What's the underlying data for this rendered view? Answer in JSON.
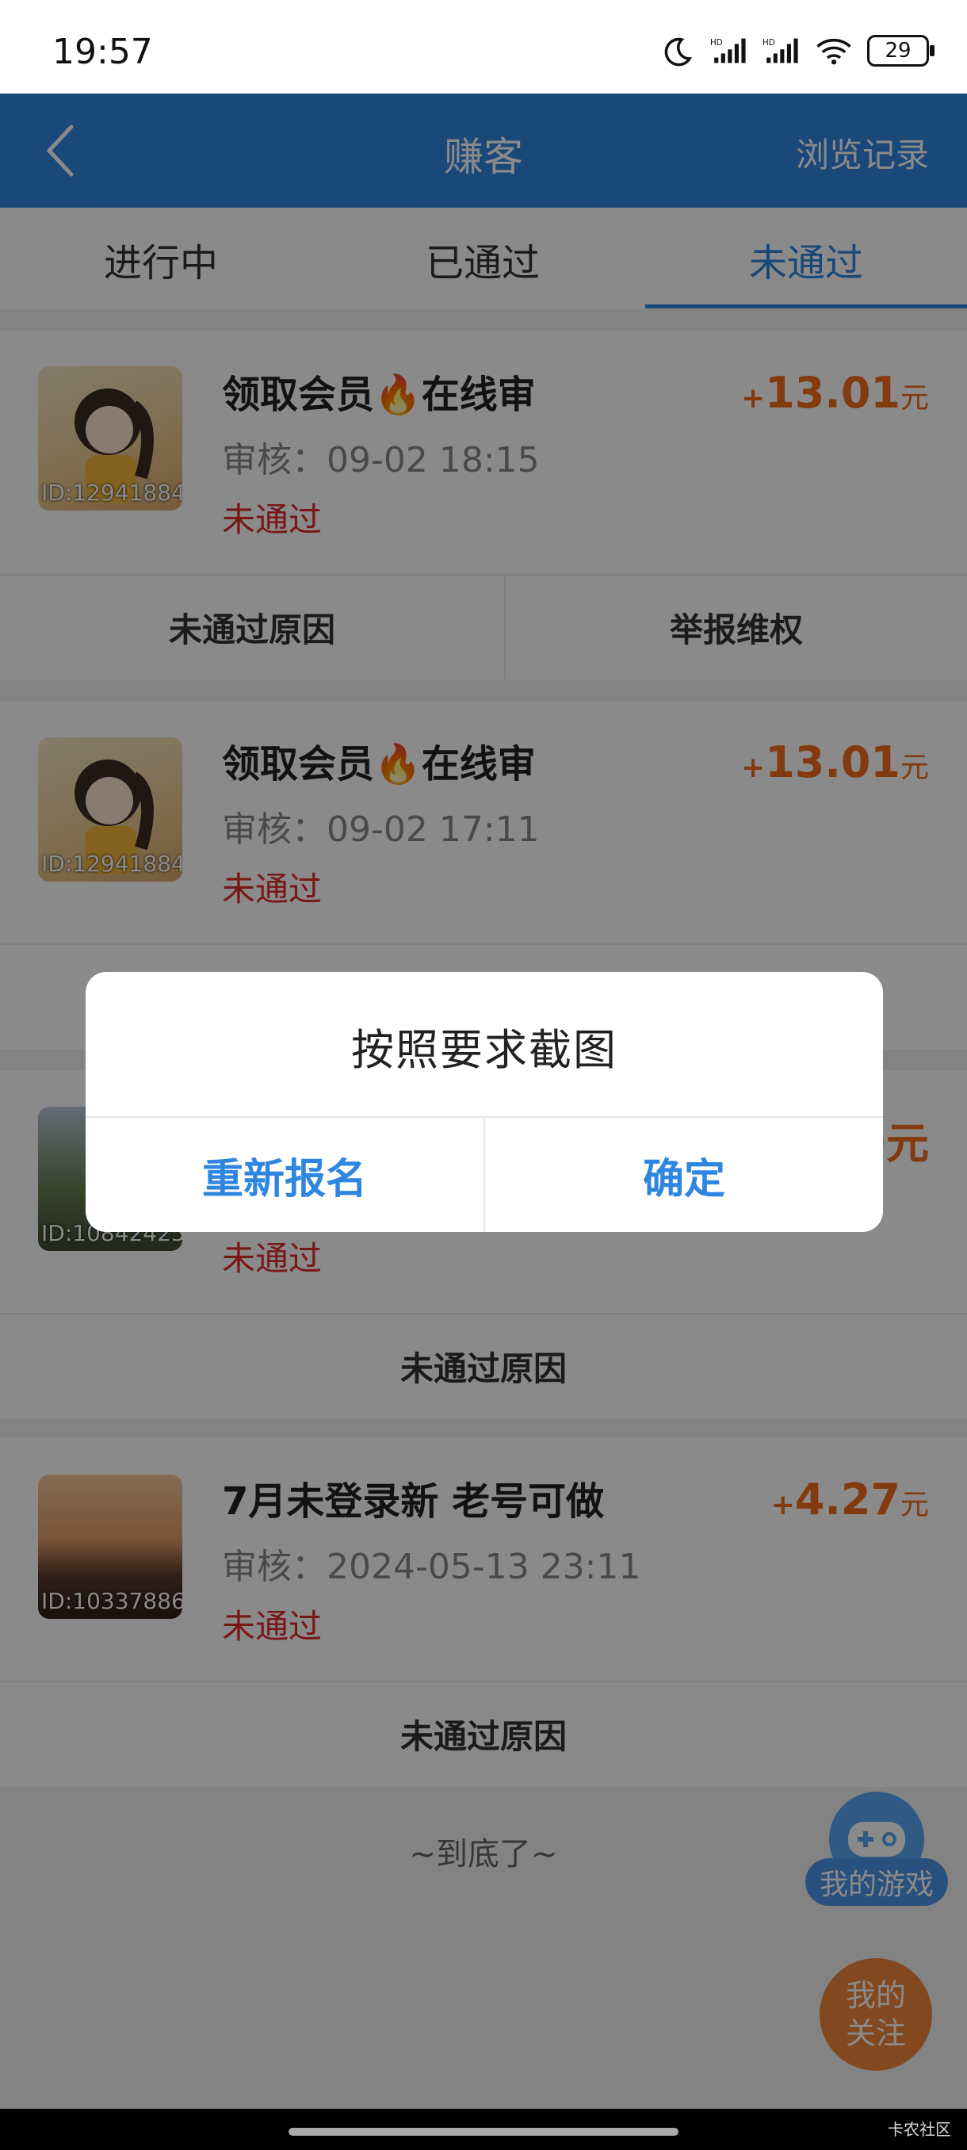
{
  "status_bar": {
    "time": "19:57",
    "battery": "29",
    "icons": [
      "moon-icon",
      "signal-hd-icon",
      "signal-hd-icon",
      "wifi-icon",
      "battery-icon"
    ]
  },
  "header": {
    "title": "赚客",
    "right_link": "浏览记录",
    "back_icon": "chevron-left-icon"
  },
  "tabs": [
    {
      "label": "进行中"
    },
    {
      "label": "已通过"
    },
    {
      "label": "未通过",
      "active": true
    }
  ],
  "cards": [
    {
      "title": "领取会员🔥在线审",
      "review_time": "审核：09-02 18:15",
      "status": "未通过",
      "price_plus": "+",
      "price": "13.01",
      "price_unit": "元",
      "image_id": "ID:12941884",
      "actions": [
        "未通过原因",
        "举报维权"
      ]
    },
    {
      "title": "领取会员🔥在线审",
      "review_time": "审核：09-02 17:11",
      "status": "未通过",
      "price_plus": "+",
      "price": "13.01",
      "price_unit": "元",
      "image_id": "ID:12941884"
    },
    {
      "status": "未通过",
      "price_partial": "9元",
      "image_id": "ID:10842425",
      "actions": [
        "未通过原因"
      ]
    },
    {
      "title": "7月未登录新 老号可做",
      "review_time": "审核：2024-05-13 23:11",
      "status": "未通过",
      "price_plus": "+",
      "price": "4.27",
      "price_unit": "元",
      "image_id": "ID:10337886",
      "actions": [
        "未通过原因"
      ]
    }
  ],
  "end_text": "~到底了~",
  "floating": {
    "game_label": "我的游戏",
    "follow_label": "我的\n关注"
  },
  "dialog": {
    "message": "按照要求截图",
    "left_button": "重新报名",
    "right_button": "确定"
  },
  "watermark": "卡农社区",
  "colors": {
    "primary": "#2f86e0",
    "price": "#f26b1d",
    "status_fail": "#e02b2b",
    "fab_orange": "#f0883b"
  }
}
